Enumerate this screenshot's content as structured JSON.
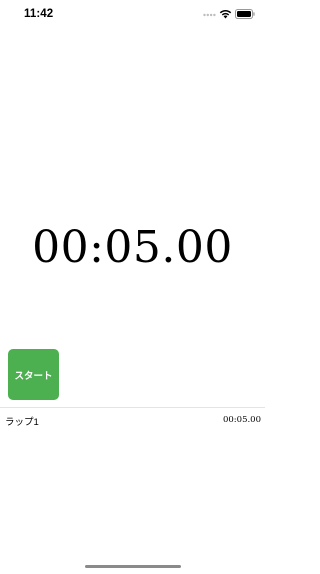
{
  "status_bar": {
    "time": "11:42",
    "icons": [
      "signal-icon",
      "wifi-icon",
      "battery-icon"
    ]
  },
  "timer": {
    "display": "00:05.00"
  },
  "controls": {
    "start_label": "スタート",
    "start_color": "#4caf50"
  },
  "laps": [
    {
      "label": "ラップ1",
      "time": "00:05.00"
    }
  ]
}
